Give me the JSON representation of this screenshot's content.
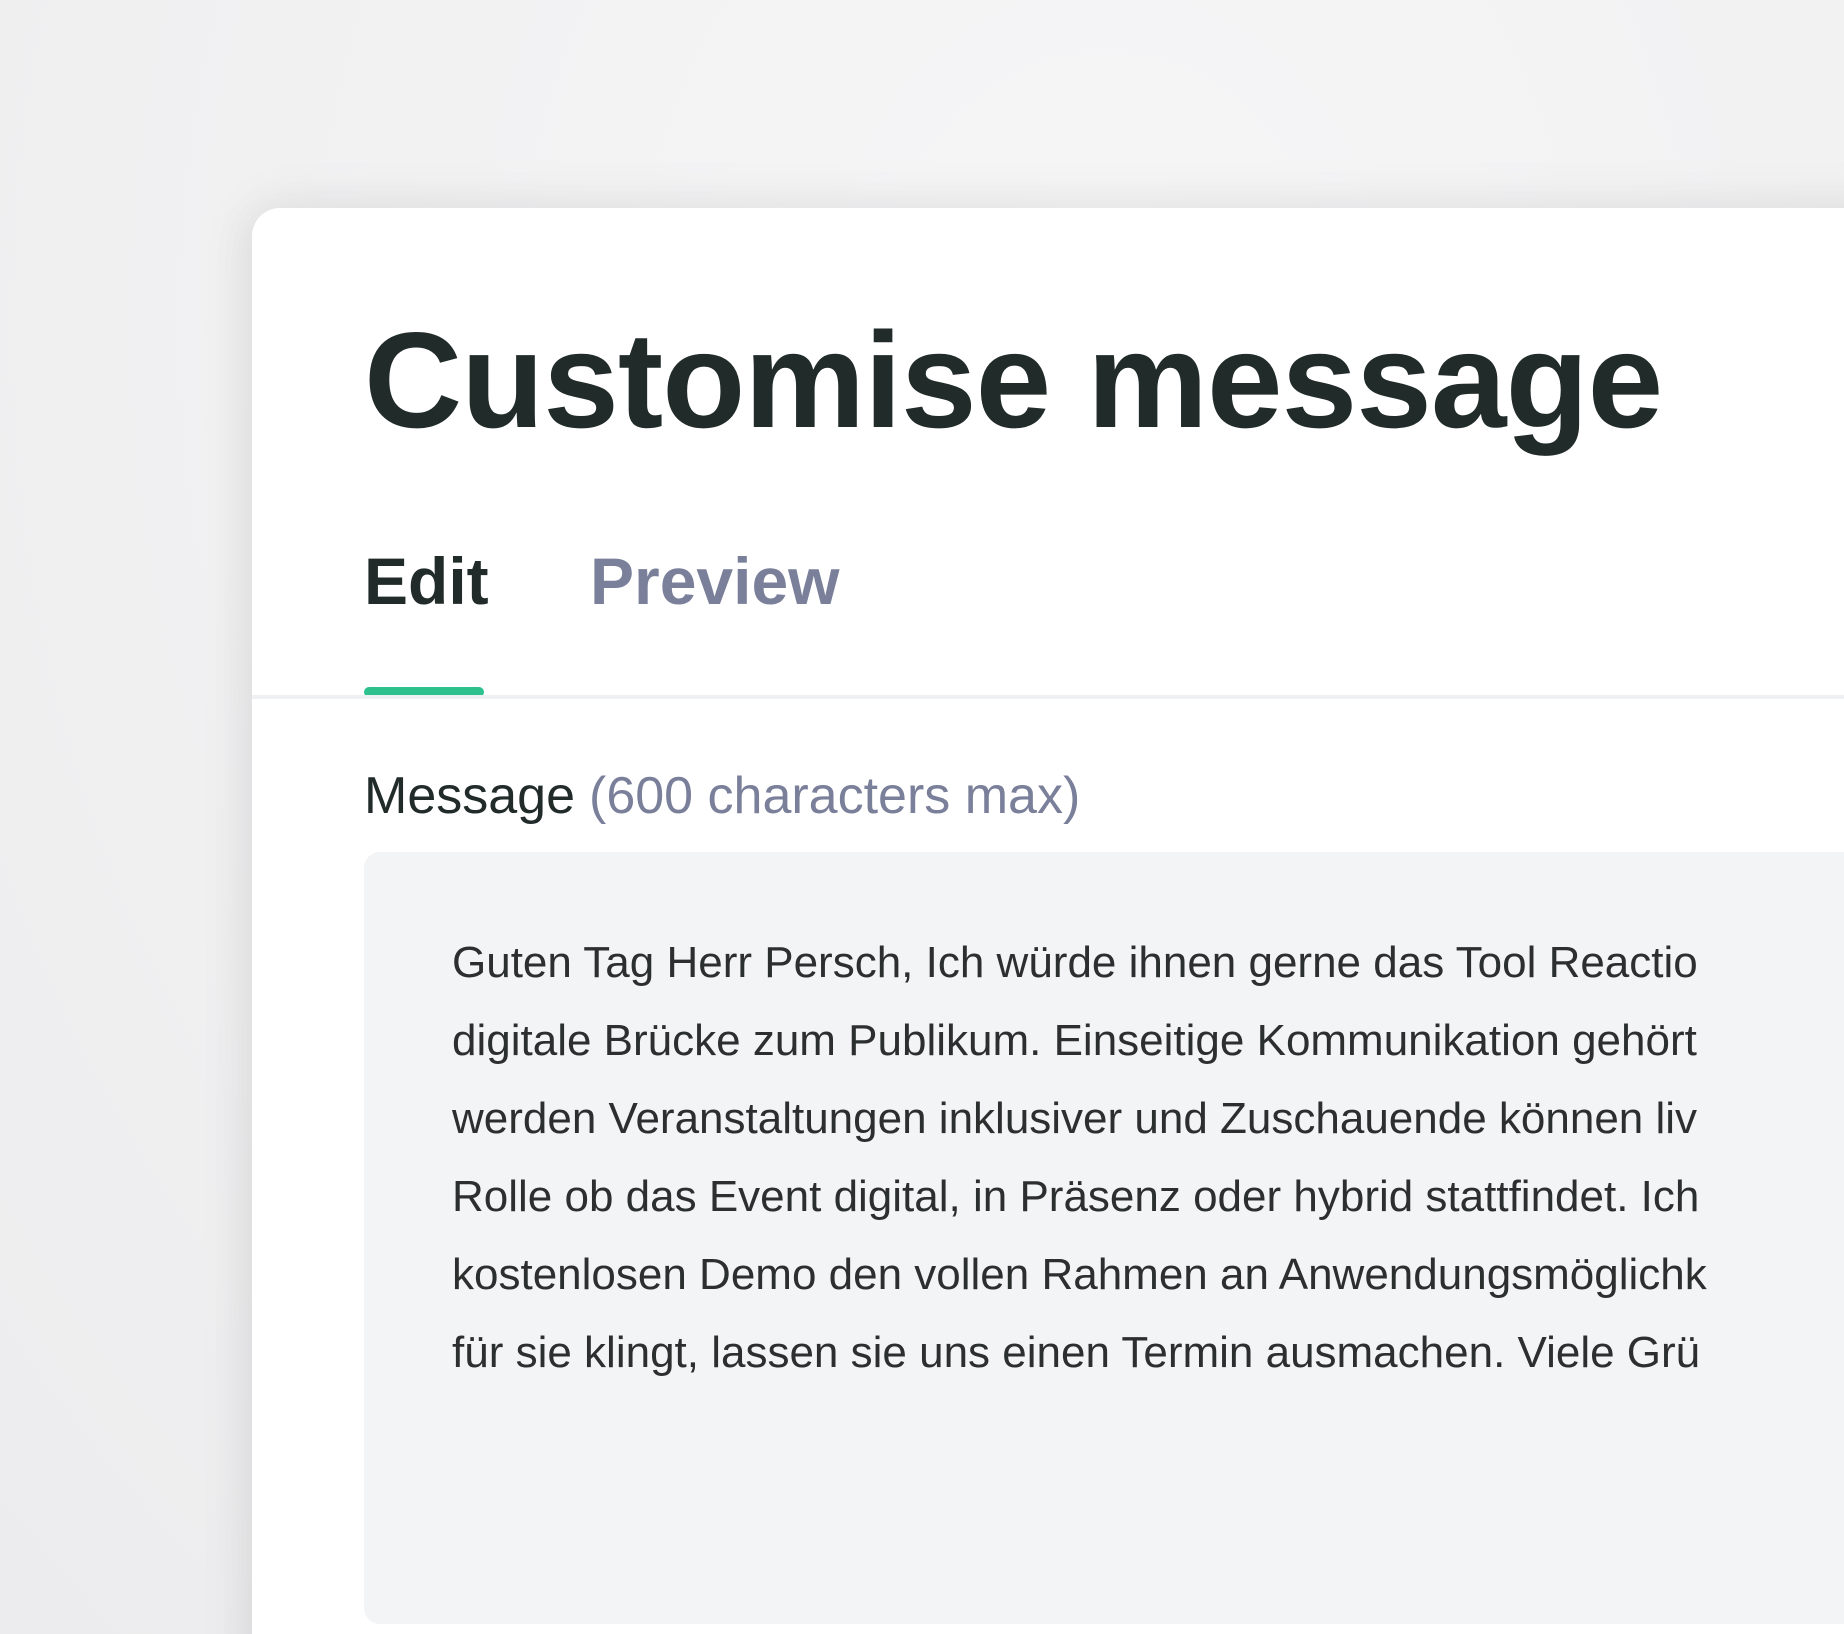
{
  "modal": {
    "title": "Customise message",
    "tabs": [
      {
        "label": "Edit",
        "active": true
      },
      {
        "label": "Preview",
        "active": false
      }
    ],
    "message_field": {
      "label": "Message",
      "hint": "(600 characters max)",
      "lines": [
        "Guten Tag Herr Persch, Ich würde ihnen gerne das Tool Reactio",
        "digitale Brücke zum Publikum. Einseitige Kommunikation gehört",
        "werden Veranstaltungen inklusiver und Zuschauende können liv",
        "Rolle ob das Event digital, in Präsenz oder hybrid stattfindet. Ich",
        "kostenlosen Demo den vollen Rahmen an Anwendungsmöglichk",
        "für sie klingt, lassen sie uns einen Termin ausmachen. Viele Grü"
      ]
    }
  },
  "colors": {
    "accent": "#2ec18e",
    "heading": "#212b29",
    "muted": "#7a7f9a",
    "field_bg": "#f3f4f6"
  }
}
